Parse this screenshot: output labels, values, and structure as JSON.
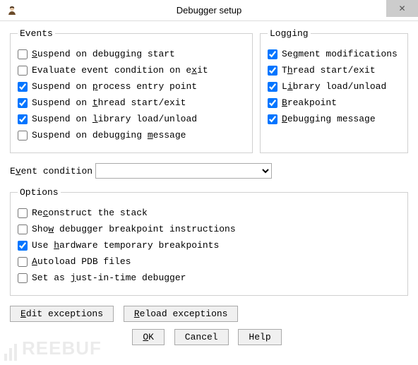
{
  "title": "Debugger setup",
  "events": {
    "legend": "Events",
    "items": [
      {
        "checked": false,
        "pre": "",
        "key": "S",
        "post": "uspend on debugging start"
      },
      {
        "checked": false,
        "pre": "Evaluate event condition on e",
        "key": "x",
        "post": "it"
      },
      {
        "checked": true,
        "pre": "Suspend on ",
        "key": "p",
        "post": "rocess entry point"
      },
      {
        "checked": true,
        "pre": "Suspend on ",
        "key": "t",
        "post": "hread start/exit"
      },
      {
        "checked": true,
        "pre": "Suspend on ",
        "key": "l",
        "post": "ibrary load/unload"
      },
      {
        "checked": false,
        "pre": "Suspend on debugging ",
        "key": "m",
        "post": "essage"
      }
    ]
  },
  "logging": {
    "legend": "Logging",
    "items": [
      {
        "checked": true,
        "pre": "Se",
        "key": "g",
        "post": "ment modifications"
      },
      {
        "checked": true,
        "pre": "T",
        "key": "h",
        "post": "read start/exit"
      },
      {
        "checked": true,
        "pre": "L",
        "key": "i",
        "post": "brary load/unload"
      },
      {
        "checked": true,
        "pre": "",
        "key": "B",
        "post": "reakpoint"
      },
      {
        "checked": true,
        "pre": "",
        "key": "D",
        "post": "ebugging message"
      }
    ]
  },
  "event_condition": {
    "pre": "E",
    "key": "v",
    "post": "ent condition",
    "value": ""
  },
  "options": {
    "legend": "Options",
    "items": [
      {
        "checked": false,
        "pre": "Re",
        "key": "c",
        "post": "onstruct the stack"
      },
      {
        "checked": false,
        "pre": "Sho",
        "key": "w",
        "post": " debugger breakpoint instructions"
      },
      {
        "checked": true,
        "pre": "Use ",
        "key": "h",
        "post": "ardware temporary breakpoints"
      },
      {
        "checked": false,
        "pre": "",
        "key": "A",
        "post": "utoload PDB files"
      },
      {
        "checked": false,
        "pre": "Set as ",
        "key": "j",
        "post": "ust-in-time debugger"
      }
    ]
  },
  "buttons": {
    "edit_exceptions": {
      "pre": "",
      "key": "E",
      "post": "dit exceptions"
    },
    "reload_exceptions": {
      "pre": "",
      "key": "R",
      "post": "eload exceptions"
    },
    "ok": {
      "pre": "",
      "key": "O",
      "post": "K"
    },
    "cancel": "Cancel",
    "help": "Help"
  },
  "watermark": "REEBUF"
}
